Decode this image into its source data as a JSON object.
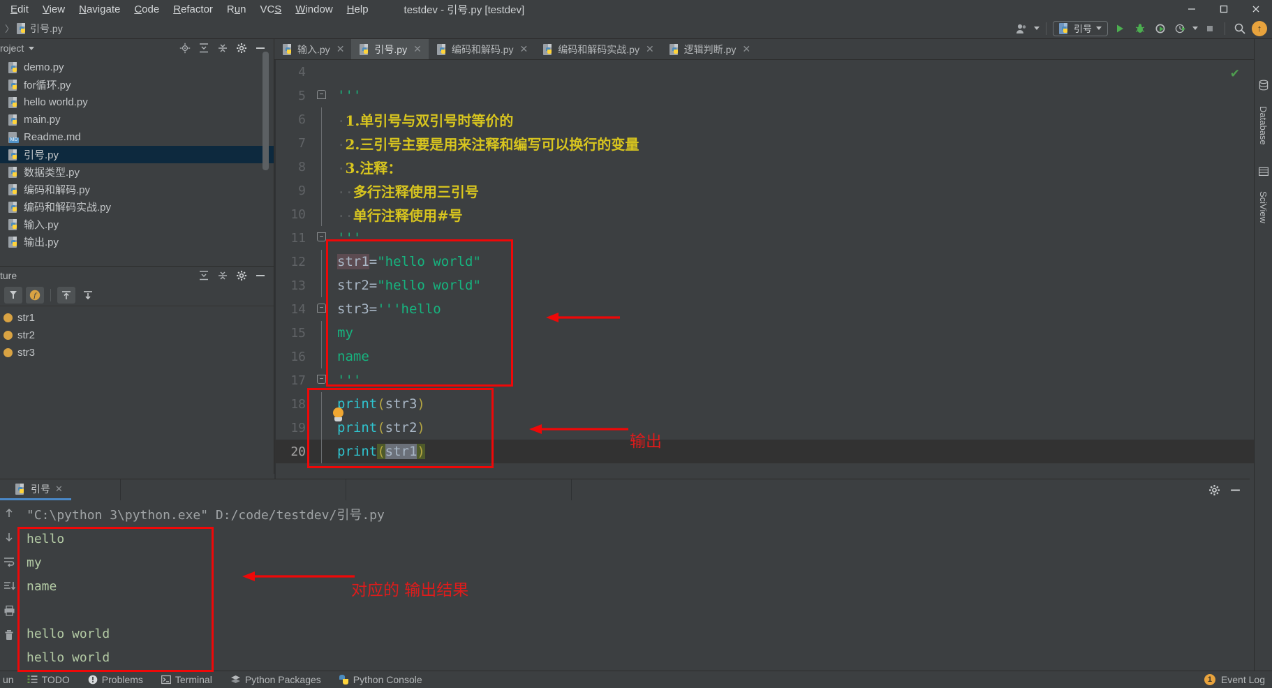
{
  "window": {
    "title": "testdev - 引号.py [testdev]",
    "minimize": "–",
    "maximize": "▢",
    "close": "✕"
  },
  "menubar": [
    {
      "label": "Edit",
      "mnemonic": "E"
    },
    {
      "label": "View",
      "mnemonic": "V"
    },
    {
      "label": "Navigate",
      "mnemonic": "N"
    },
    {
      "label": "Code",
      "mnemonic": "C"
    },
    {
      "label": "Refactor",
      "mnemonic": "R"
    },
    {
      "label": "Run",
      "mnemonic": "R"
    },
    {
      "label": "VCS",
      "mnemonic": "S"
    },
    {
      "label": "Window",
      "mnemonic": "W"
    },
    {
      "label": "Help",
      "mnemonic": "H"
    }
  ],
  "breadcrumb": {
    "separator": "〉",
    "file": "引号.py"
  },
  "toolbar": {
    "account_icon": "user-icon",
    "run_config": "引号",
    "run_label": "run-icon",
    "debug_label": "debug-icon",
    "coverage_label": "run-coverage-icon",
    "profile_label": "profile-icon",
    "stop_label": "stop-icon",
    "search_label": "search-icon",
    "update_badge": "↑"
  },
  "project_panel": {
    "title": "roject",
    "files": [
      {
        "name": "demo.py",
        "type": "py",
        "selected": false
      },
      {
        "name": "for循环.py",
        "type": "py",
        "selected": false
      },
      {
        "name": "hello world.py",
        "type": "py",
        "selected": false
      },
      {
        "name": "main.py",
        "type": "py",
        "selected": false
      },
      {
        "name": "Readme.md",
        "type": "md",
        "selected": false
      },
      {
        "name": "引号.py",
        "type": "py",
        "selected": true
      },
      {
        "name": "数据类型.py",
        "type": "py",
        "selected": false
      },
      {
        "name": "编码和解码.py",
        "type": "py",
        "selected": false
      },
      {
        "name": "编码和解码实战.py",
        "type": "py",
        "selected": false
      },
      {
        "name": "输入.py",
        "type": "py",
        "selected": false
      },
      {
        "name": "输出.py",
        "type": "py",
        "selected": false
      }
    ]
  },
  "structure_panel": {
    "title": "ture",
    "items": [
      {
        "name": "str1"
      },
      {
        "name": "str2"
      },
      {
        "name": "str3"
      }
    ]
  },
  "editor_tabs": [
    {
      "label": "输入.py",
      "active": false,
      "close": "✕"
    },
    {
      "label": "引号.py",
      "active": true,
      "close": "✕"
    },
    {
      "label": "编码和解码.py",
      "active": false,
      "close": "✕"
    },
    {
      "label": "编码和解码实战.py",
      "active": false,
      "close": "✕"
    },
    {
      "label": "逻辑判断.py",
      "active": false,
      "close": "✕"
    }
  ],
  "editor": {
    "inspection_status": "✔",
    "lines": [
      {
        "num": "4",
        "text": "",
        "kind": "blank"
      },
      {
        "num": "5",
        "text": "'''",
        "kind": "quote",
        "fold": "top"
      },
      {
        "num": "6",
        "text": "1.单引号与双引号时等价的",
        "kind": "comment"
      },
      {
        "num": "7",
        "text": "2.三引号主要是用来注释和编写可以换行的变量",
        "kind": "comment"
      },
      {
        "num": "8",
        "text": "3.注释：",
        "kind": "comment"
      },
      {
        "num": "9",
        "text": "多行注释使用三引号",
        "kind": "comment",
        "indent": 2
      },
      {
        "num": "10",
        "text": "单行注释使用#号",
        "kind": "comment",
        "indent": 2
      },
      {
        "num": "11",
        "text": "'''",
        "kind": "quote",
        "fold": "bot"
      },
      {
        "num": "12",
        "text": "str1=\"hello world\"",
        "kind": "assign-dq",
        "var": "str1",
        "value": "\"hello world\"",
        "highlight": "ident"
      },
      {
        "num": "13",
        "text": "str2=\"hello world\"",
        "kind": "assign-dq",
        "var": "str2",
        "value": "\"hello world\""
      },
      {
        "num": "14",
        "text": "str3='''hello",
        "kind": "assign-tq",
        "var": "str3",
        "value": "'''hello",
        "fold": "top"
      },
      {
        "num": "15",
        "text": "my",
        "kind": "str"
      },
      {
        "num": "16",
        "text": "name",
        "kind": "str"
      },
      {
        "num": "17",
        "text": "'''",
        "kind": "quote",
        "fold": "bot"
      },
      {
        "num": "18",
        "text": "print(str3)",
        "kind": "call",
        "func": "print",
        "arg": "str3"
      },
      {
        "num": "19",
        "text": "print(str2)",
        "kind": "call",
        "func": "print",
        "arg": "str2",
        "bulb": true
      },
      {
        "num": "20",
        "text": "print(str1)",
        "kind": "call",
        "func": "print",
        "arg": "str1",
        "current": true,
        "highlight": "sel"
      }
    ]
  },
  "run_panel": {
    "tab_label": "引号",
    "tab_close": "✕",
    "console": [
      {
        "text": "\"C:\\python 3\\python.exe\" D:/code/testdev/引号.py",
        "kind": "cmd"
      },
      {
        "text": "hello",
        "kind": "out"
      },
      {
        "text": "my",
        "kind": "out"
      },
      {
        "text": "name",
        "kind": "out"
      },
      {
        "text": "",
        "kind": "out"
      },
      {
        "text": "hello world",
        "kind": "out"
      },
      {
        "text": "hello world",
        "kind": "out"
      }
    ]
  },
  "annotations": [
    {
      "id": "code-strings-box",
      "label": "string-definitions-highlight"
    },
    {
      "id": "code-prints-box",
      "label": "print-statements-highlight"
    },
    {
      "id": "console-output-box",
      "label": "console-output-highlight"
    },
    {
      "id": "arrow-1",
      "label": "arrow-pointing-to-strings"
    },
    {
      "id": "arrow-2",
      "label": "arrow-pointing-to-prints",
      "text": "输出"
    },
    {
      "id": "arrow-3",
      "label": "arrow-pointing-to-console",
      "text": "对应的 输出结果"
    }
  ],
  "annotation_texts": {
    "output": "输出",
    "result": "对应的 输出结果"
  },
  "right_strip": [
    {
      "label": "Database"
    },
    {
      "label": "SciView"
    }
  ],
  "statusbar": {
    "left_cut": "un",
    "items": [
      {
        "label": "TODO",
        "icon": "todo-icon"
      },
      {
        "label": "Problems",
        "icon": "problems-icon"
      },
      {
        "label": "Terminal",
        "icon": "terminal-icon"
      },
      {
        "label": "Python Packages",
        "icon": "packages-icon"
      },
      {
        "label": "Python Console",
        "icon": "python-console-icon"
      }
    ],
    "event_log": "Event Log",
    "event_count": "1"
  },
  "colors": {
    "bg": "#3c3f41",
    "editor_bg": "#3c3f41",
    "selected_row": "#0d293e",
    "annotation_red": "#ef0808",
    "comment_yellow": "#d8c51f",
    "string_green": "#16b47f",
    "func_cyan": "#2fc4cf",
    "accent_blue": "#4a88c7",
    "badge_orange": "#e8a33d"
  }
}
